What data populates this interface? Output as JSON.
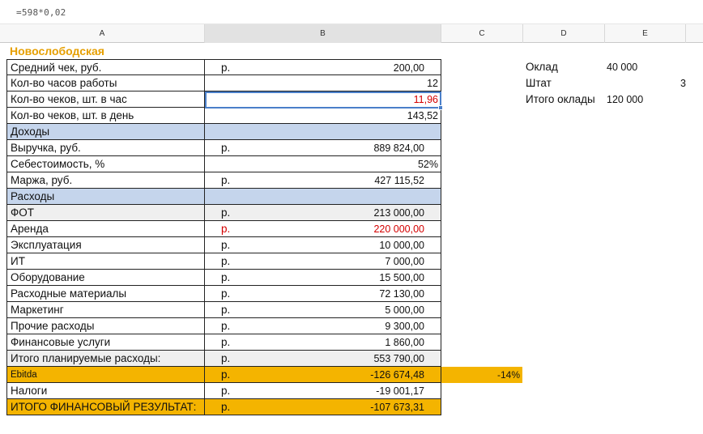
{
  "formula": "=598*0,02",
  "columns": [
    "A",
    "B",
    "C",
    "D",
    "E"
  ],
  "sheet": {
    "title": "Новослободская",
    "rows": [
      {
        "label": "Средний чек, руб.",
        "unit": "р.",
        "value": "200,00"
      },
      {
        "label": "Кол-во часов работы",
        "unit": "",
        "value": "12"
      },
      {
        "label": "Кол-во чеков, шт. в час",
        "unit": "",
        "value": "11,96"
      },
      {
        "label": "Кол-во чеков, шт. в день",
        "unit": "",
        "value": "143,52"
      },
      {
        "label": "Доходы",
        "unit": "",
        "value": ""
      },
      {
        "label": "Выручка, руб.",
        "unit": "р.",
        "value": "889 824,00"
      },
      {
        "label": "Себестоимость, %",
        "unit": "",
        "value": "52%"
      },
      {
        "label": "Маржа, руб.",
        "unit": "р.",
        "value": "427 115,52"
      },
      {
        "label": "Расходы",
        "unit": "",
        "value": ""
      },
      {
        "label": "ФОТ",
        "unit": "р.",
        "value": "213 000,00"
      },
      {
        "label": "Аренда",
        "unit": "р.",
        "value": "220 000,00"
      },
      {
        "label": "Эксплуатация",
        "unit": "р.",
        "value": "10 000,00"
      },
      {
        "label": "ИТ",
        "unit": "р.",
        "value": "7 000,00"
      },
      {
        "label": "Оборудование",
        "unit": "р.",
        "value": "15 500,00"
      },
      {
        "label": "Расходные материалы",
        "unit": "р.",
        "value": "72 130,00"
      },
      {
        "label": "Маркетинг",
        "unit": "р.",
        "value": "5 000,00"
      },
      {
        "label": "Прочие расходы",
        "unit": "р.",
        "value": "9 300,00"
      },
      {
        "label": "Финансовые услуги",
        "unit": "р.",
        "value": "1 860,00"
      },
      {
        "label": "Итого планируемые расходы:",
        "unit": "р.",
        "value": "553 790,00"
      },
      {
        "label": "Ebitda",
        "unit": "р.",
        "value": "-126 674,48",
        "percent": "-14%"
      },
      {
        "label": "Налоги",
        "unit": "р.",
        "value": "-19 001,17"
      },
      {
        "label": "ИТОГО ФИНАНСОВЫЙ РЕЗУЛЬТАТ:",
        "unit": "р.",
        "value": "-107 673,31"
      }
    ],
    "side": [
      {
        "label": "Оклад",
        "value": "40 000"
      },
      {
        "label": "Штат",
        "value": "3"
      },
      {
        "label": "Итого оклады",
        "value": "120 000"
      }
    ]
  },
  "colors": {
    "title": "#e69f00",
    "section_fill": "#c5d5ec",
    "total_fill": "#efefef",
    "highlight_fill": "#f4b400",
    "negative_text": "#d40000",
    "selection": "#4a7fc9"
  }
}
